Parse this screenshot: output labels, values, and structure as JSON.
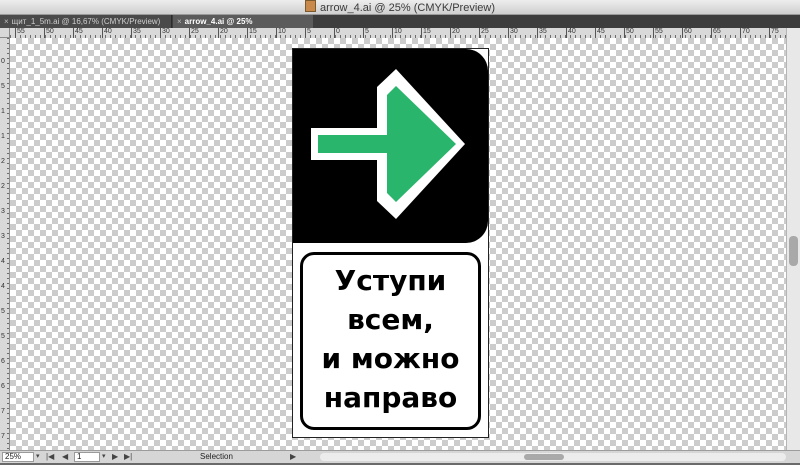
{
  "window": {
    "title": "arrow_4.ai @ 25% (CMYK/Preview)"
  },
  "tabs": [
    {
      "label": "щит_1_5m.ai @ 16,67% (CMYK/Preview)",
      "close": "×"
    },
    {
      "label": "arrow_4.ai @ 25% (CMYK/Preview)",
      "close": "×"
    }
  ],
  "ruler": {
    "h_ticks": [
      "55",
      "50",
      "45",
      "40",
      "35",
      "30",
      "25",
      "20",
      "15",
      "10",
      "5",
      "0",
      "5",
      "10",
      "15",
      "20",
      "25",
      "30",
      "35",
      "40",
      "45",
      "50",
      "55",
      "60",
      "65",
      "70",
      "75"
    ],
    "v_ticks": [
      "0",
      "5",
      "1",
      "1",
      "2",
      "2",
      "3",
      "3",
      "4",
      "4",
      "5",
      "5",
      "6",
      "6",
      "7",
      "7",
      "8"
    ]
  },
  "sign": {
    "arrow_color": "#2ab56c",
    "background": "#000000",
    "text_lines": [
      "Уступи",
      "всем,",
      "и можно",
      "направо"
    ]
  },
  "status": {
    "zoom": "25%",
    "page": "1",
    "tool": "Selection",
    "nav": {
      "first": "|◀",
      "prev": "◀",
      "next": "▶",
      "last": "▶|",
      "dropdown": "▾",
      "arrow": "▶"
    }
  }
}
